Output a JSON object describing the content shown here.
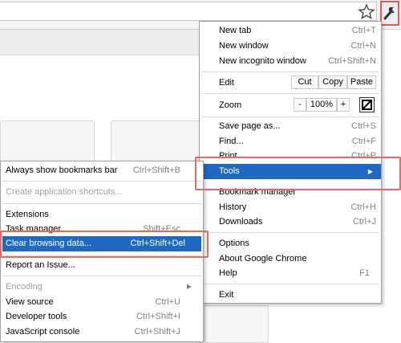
{
  "toolbar": {
    "star_icon": "star-icon",
    "wrench_icon": "wrench-icon",
    "highlight_color": "#e35a4f"
  },
  "main_menu": {
    "new_tab": {
      "label": "New tab",
      "shortcut": "Ctrl+T"
    },
    "new_window": {
      "label": "New window",
      "shortcut": "Ctrl+N"
    },
    "new_incognito": {
      "label": "New incognito window",
      "shortcut": "Ctrl+Shift+N"
    },
    "edit": {
      "label": "Edit",
      "cut": "Cut",
      "copy": "Copy",
      "paste": "Paste"
    },
    "zoom": {
      "label": "Zoom",
      "minus": "-",
      "value": "100%",
      "plus": "+",
      "fullscreen_icon": "fullscreen-icon"
    },
    "save_page": {
      "label": "Save page as...",
      "shortcut": "Ctrl+S"
    },
    "find": {
      "label": "Find...",
      "shortcut": "Ctrl+F"
    },
    "print": {
      "label": "Print...",
      "shortcut": "Ctrl+P"
    },
    "tools": {
      "label": "Tools",
      "arrow": "▶"
    },
    "bookmark_manager": {
      "label": "Bookmark manager"
    },
    "history": {
      "label": "History",
      "shortcut": "Ctrl+H"
    },
    "downloads": {
      "label": "Downloads",
      "shortcut": "Ctrl+J"
    },
    "options": {
      "label": "Options"
    },
    "about": {
      "label": "About Google Chrome"
    },
    "help": {
      "label": "Help",
      "shortcut": "F1"
    },
    "exit": {
      "label": "Exit"
    }
  },
  "tools_menu": {
    "bookmarks_bar": {
      "label": "Always show bookmarks bar",
      "shortcut": "Ctrl+Shift+B"
    },
    "app_shortcuts": {
      "label": "Create application shortcuts..."
    },
    "extensions": {
      "label": "Extensions"
    },
    "task_manager": {
      "label": "Task manager",
      "shortcut": "Shift+Esc"
    },
    "clear_data": {
      "label": "Clear browsing data...",
      "shortcut": "Ctrl+Shift+Del"
    },
    "report_issue": {
      "label": "Report an Issue..."
    },
    "encoding": {
      "label": "Encoding",
      "arrow": "▶"
    },
    "view_source": {
      "label": "View source",
      "shortcut": "Ctrl+U"
    },
    "developer_tools": {
      "label": "Developer tools",
      "shortcut": "Ctrl+Shift+I"
    },
    "js_console": {
      "label": "JavaScript console",
      "shortcut": "Ctrl+Shift+J"
    }
  }
}
